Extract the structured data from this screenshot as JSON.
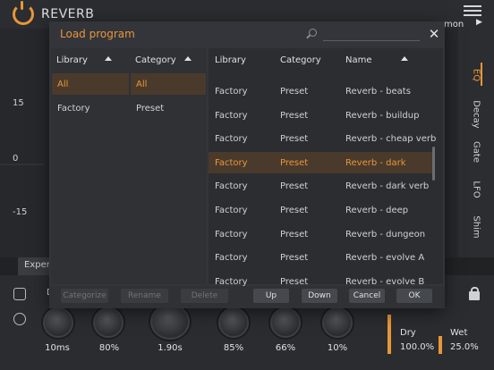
{
  "app": {
    "title": "REVERB",
    "preset_name": "mon",
    "preset_arrow": "▶"
  },
  "graph": {
    "db_labels": [
      "15",
      "0",
      "-15"
    ]
  },
  "side_tabs": [
    "EQ",
    "Decay",
    "Gate",
    "LFO",
    "Shim"
  ],
  "expert_tab": "Expert",
  "bottom": {
    "knob_values": [
      "10ms",
      "80%",
      "1.90s",
      "85%",
      "66%",
      "10%"
    ],
    "dry_label": "Dry",
    "dry_value": "100.0%",
    "wet_label": "Wet",
    "wet_value": "25.0%",
    "partial_label": "D"
  },
  "dialog": {
    "title": "Load program",
    "search_placeholder": "",
    "close_glyph": "✕",
    "filter_headers": [
      "Library",
      "Category"
    ],
    "library_options": [
      "All",
      "Factory"
    ],
    "category_options": [
      "All",
      "Preset"
    ],
    "list_headers": [
      "Library",
      "Category",
      "Name"
    ],
    "rows": [
      {
        "library": "Factory",
        "category": "Preset",
        "name": "Reverb - beats"
      },
      {
        "library": "Factory",
        "category": "Preset",
        "name": "Reverb - buildup"
      },
      {
        "library": "Factory",
        "category": "Preset",
        "name": "Reverb - cheap verb"
      },
      {
        "library": "Factory",
        "category": "Preset",
        "name": "Reverb - dark"
      },
      {
        "library": "Factory",
        "category": "Preset",
        "name": "Reverb - dark verb"
      },
      {
        "library": "Factory",
        "category": "Preset",
        "name": "Reverb - deep"
      },
      {
        "library": "Factory",
        "category": "Preset",
        "name": "Reverb - dungeon"
      },
      {
        "library": "Factory",
        "category": "Preset",
        "name": "Reverb - evolve A"
      },
      {
        "library": "Factory",
        "category": "Preset",
        "name": "Reverb - evolve B"
      }
    ],
    "selected_row_index": 3,
    "buttons": {
      "categorize": "Categorize",
      "rename": "Rename",
      "delete": "Delete",
      "up": "Up",
      "down": "Down",
      "cancel": "Cancel",
      "ok": "OK"
    }
  },
  "colors": {
    "accent": "#e8963a",
    "selection_bg": "#4a3a2c"
  }
}
